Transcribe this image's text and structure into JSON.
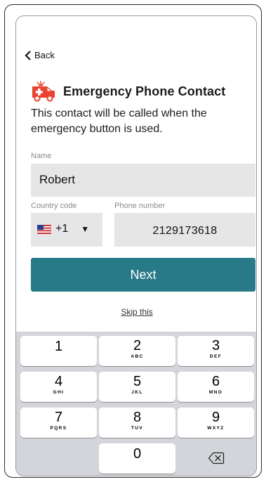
{
  "nav": {
    "back_label": "Back"
  },
  "header": {
    "title": "Emergency Phone Contact",
    "subtitle": "This contact will be called when the emergency button is used."
  },
  "form": {
    "name_label": "Name",
    "name_value": "Robert",
    "country_label": "Country code",
    "country_value": "+1",
    "phone_label": "Phone number",
    "phone_value": "2129173618"
  },
  "actions": {
    "next_label": "Next",
    "skip_label": "Skip this"
  },
  "keypad": {
    "keys": [
      {
        "digit": "1",
        "letters": ""
      },
      {
        "digit": "2",
        "letters": "ABC"
      },
      {
        "digit": "3",
        "letters": "DEF"
      },
      {
        "digit": "4",
        "letters": "GHI"
      },
      {
        "digit": "5",
        "letters": "JKL"
      },
      {
        "digit": "6",
        "letters": "MNO"
      },
      {
        "digit": "7",
        "letters": "PQRS"
      },
      {
        "digit": "8",
        "letters": "TUV"
      },
      {
        "digit": "9",
        "letters": "WXYZ"
      },
      {
        "digit": "0",
        "letters": ""
      }
    ]
  },
  "colors": {
    "accent": "#287a88",
    "ambulance": "#e8432e",
    "field_bg": "#e6e6e6",
    "keypad_bg": "#d3d5da"
  }
}
